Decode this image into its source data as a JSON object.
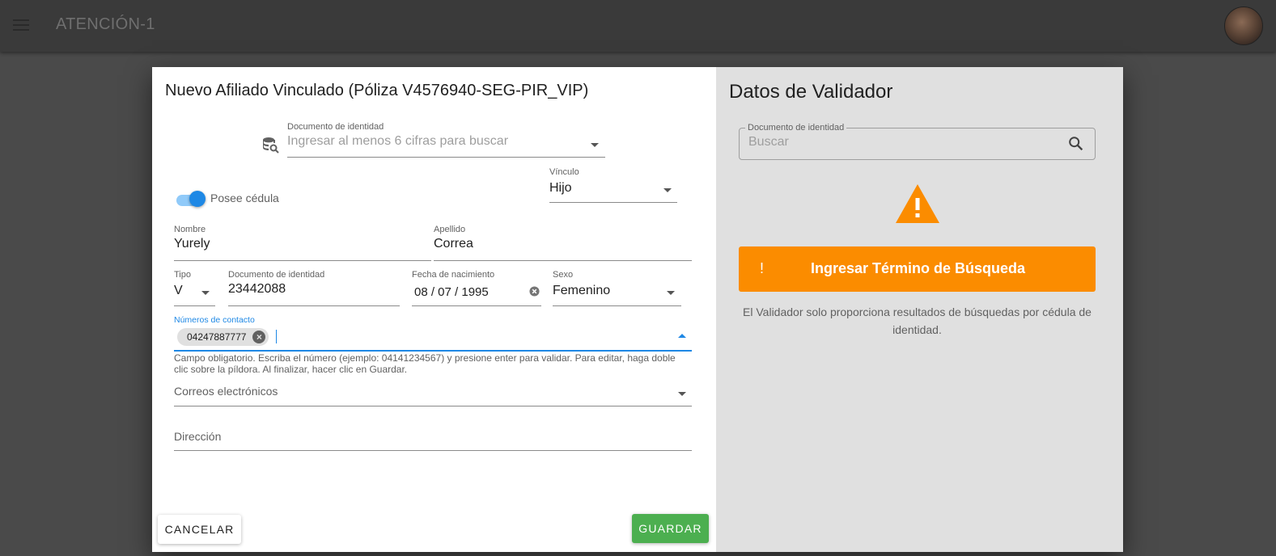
{
  "app": {
    "title": "ATENCIÓN-1"
  },
  "dialog": {
    "title": "Nuevo Afiliado Vinculado (Póliza V4576940-SEG-PIR_VIP)",
    "search": {
      "label": "Documento de identidad",
      "placeholder": "Ingresar al menos 6 cifras para buscar"
    },
    "toggle": {
      "label": "Posee cédula",
      "on": true
    },
    "vinculo": {
      "label": "Vínculo",
      "value": "Hijo"
    },
    "nombre": {
      "label": "Nombre",
      "value": "Yurely"
    },
    "apellido": {
      "label": "Apellido",
      "value": "Correa"
    },
    "tipo": {
      "label": "Tipo",
      "value": "V"
    },
    "documento": {
      "label": "Documento de identidad",
      "value": "23442088"
    },
    "fecha": {
      "label": "Fecha de nacimiento",
      "value": "08 / 07 / 1995"
    },
    "sexo": {
      "label": "Sexo",
      "value": "Femenino"
    },
    "contactos": {
      "label": "Números de contacto",
      "chips": [
        "04247887777"
      ],
      "helper": "Campo obligatorio. Escriba el número (ejemplo: 04141234567) y presione enter para validar. Para editar, haga doble clic sobre la píldora. Al finalizar, hacer clic en Guardar."
    },
    "correos": {
      "placeholder": "Correos electrónicos"
    },
    "direccion": {
      "placeholder": "Dirección"
    },
    "buttons": {
      "cancel": "Cancelar",
      "save": "Guardar"
    }
  },
  "validator": {
    "title": "Datos de Validador",
    "search": {
      "label": "Documento de identidad",
      "placeholder": "Buscar"
    },
    "banner": {
      "mark": "!",
      "text": "Ingresar Término de Búsqueda"
    },
    "note": "El Validador solo proporciona resultados de búsquedas por cédula de identidad."
  },
  "colors": {
    "accent": "#1e88e5",
    "save": "#4caf50",
    "warning": "#fb8c00"
  }
}
